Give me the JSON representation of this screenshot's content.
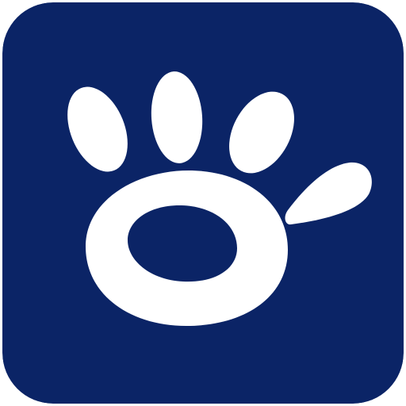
{
  "app_icon": {
    "icon": "paw-hand-icon",
    "colors": {
      "background": "#0b2466",
      "glyph": "#ffffff"
    }
  }
}
